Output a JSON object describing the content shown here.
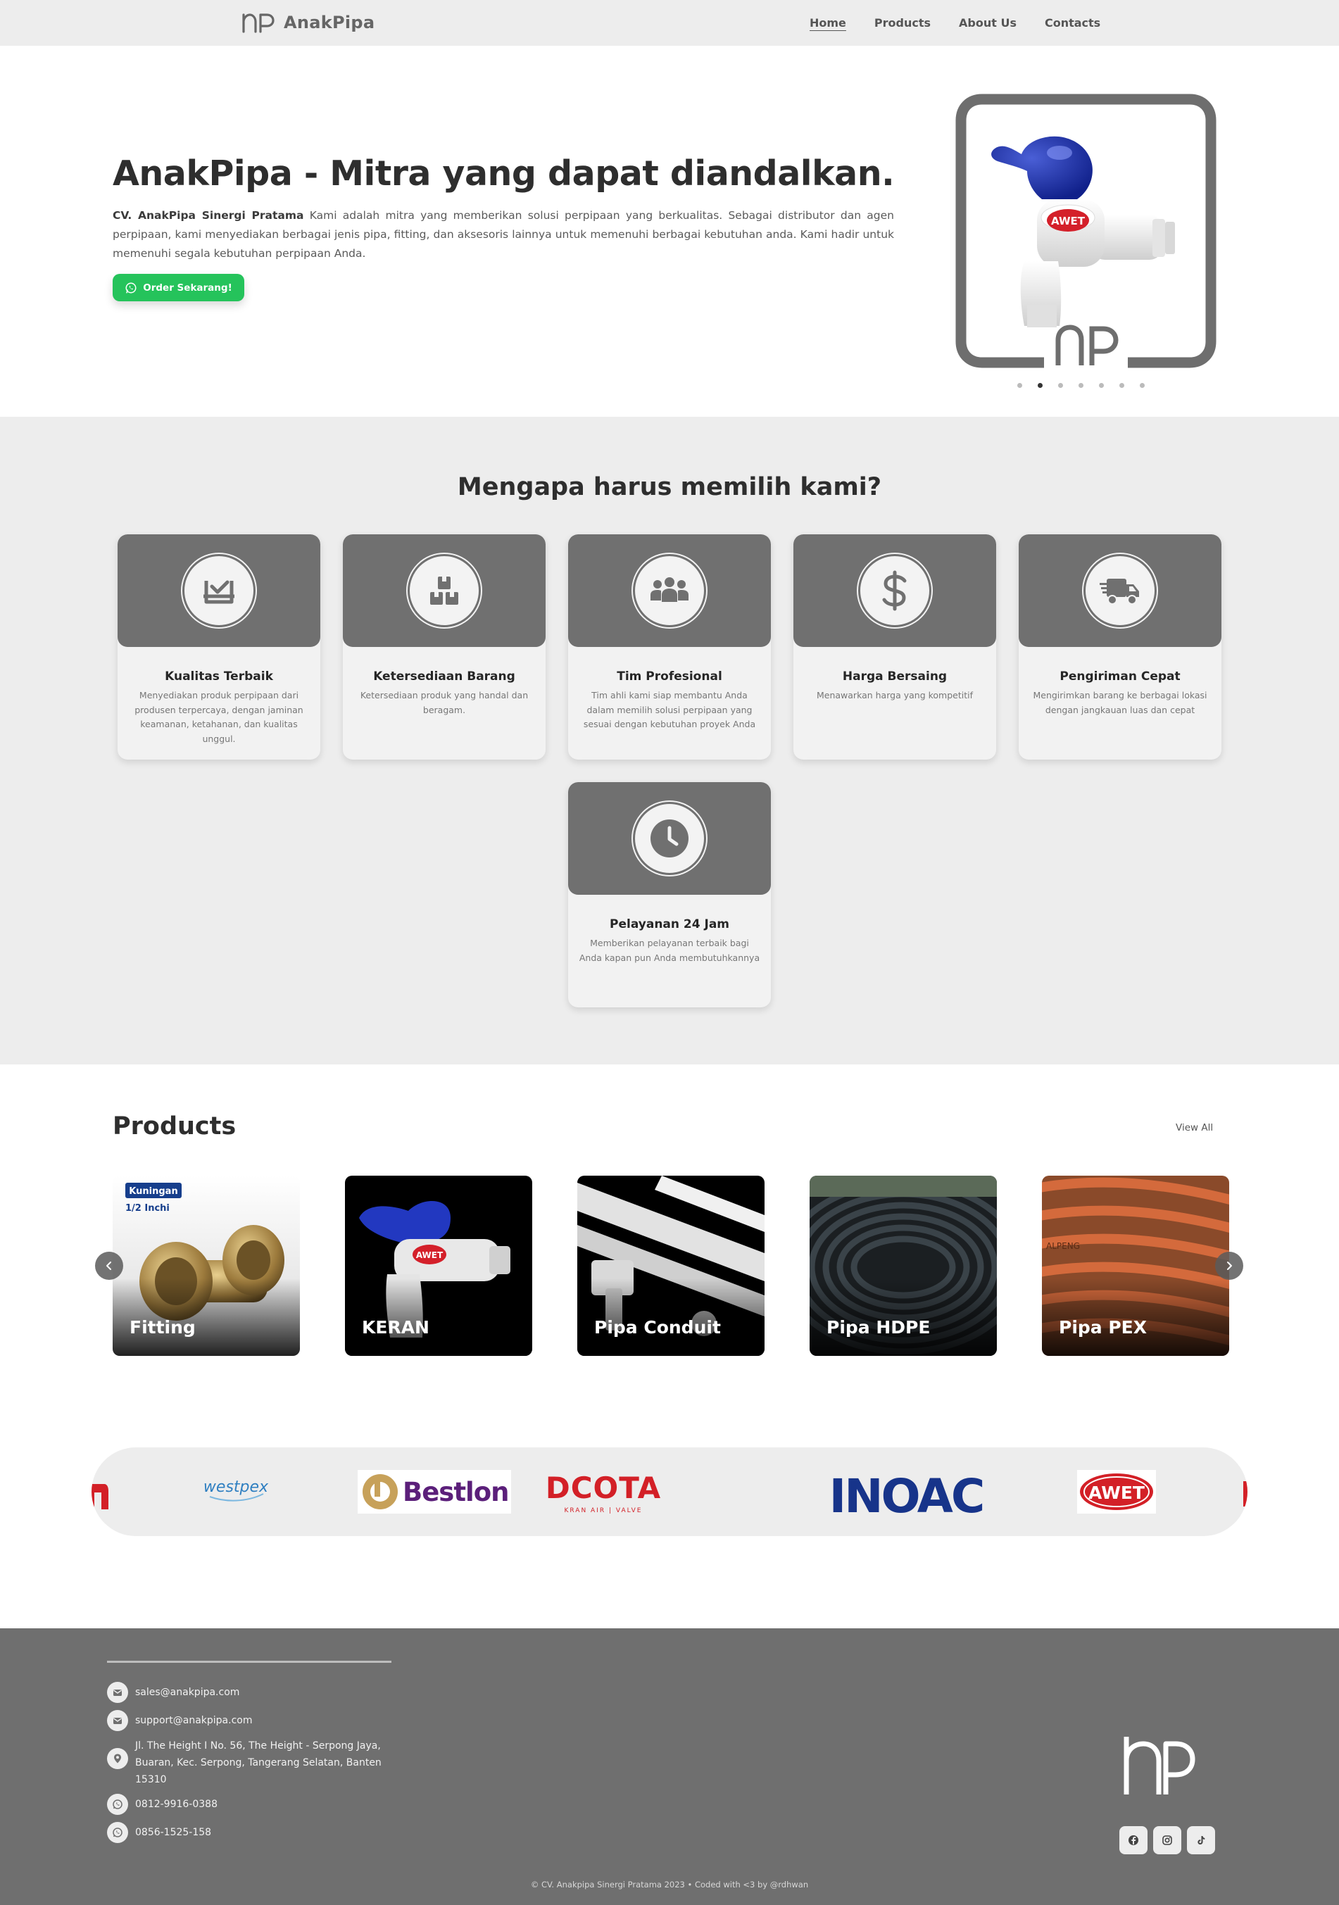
{
  "nav": {
    "brand": "AnakPipa",
    "links": [
      "Home",
      "Products",
      "About Us",
      "Contacts"
    ]
  },
  "hero": {
    "title": "AnakPipa - Mitra yang dapat diandalkan.",
    "company": "CV. AnakPipa Sinergi Pratama",
    "description": " Kami adalah mitra yang memberikan solusi perpipaan yang berkualitas. Sebagai distributor dan agen perpipaan, kami menyediakan berbagai jenis pipa, fitting, dan aksesoris lainnya untuk memenuhi berbagai kebutuhan anda. Kami hadir untuk memenuhi segala kebutuhan perpipaan Anda.",
    "cta": "Order Sekarang!",
    "carousel_dots": 7,
    "active_dot": 1,
    "image_brand": "AWET"
  },
  "why": {
    "title": "Mengapa harus memilih kami?",
    "cards": [
      {
        "title": "Kualitas Terbaik",
        "desc": "Menyediakan produk perpipaan dari produsen terpercaya, dengan jaminan keamanan, ketahanan, dan kualitas unggul.",
        "icon": "quality-check-icon"
      },
      {
        "title": "Ketersediaan Barang",
        "desc": "Ketersediaan produk yang handal dan beragam.",
        "icon": "boxes-icon"
      },
      {
        "title": "Tim Profesional",
        "desc": "Tim ahli kami siap membantu Anda dalam memilih solusi perpipaan yang sesuai dengan kebutuhan proyek Anda",
        "icon": "team-icon"
      },
      {
        "title": "Harga Bersaing",
        "desc": "Menawarkan harga yang kompetitif",
        "icon": "dollar-icon"
      },
      {
        "title": "Pengiriman Cepat",
        "desc": "Mengirimkan barang ke berbagai lokasi dengan jangkauan luas dan cepat",
        "icon": "truck-icon"
      },
      {
        "title": "Pelayanan 24 Jam",
        "desc": "Memberikan pelayanan terbaik bagi Anda kapan pun Anda membutuhkannya",
        "icon": "clock-icon"
      }
    ]
  },
  "products": {
    "title": "Products",
    "view_all": "View All",
    "items": [
      {
        "label": "Fitting",
        "tag1": "Kuningan",
        "tag2": "1/2 Inchi"
      },
      {
        "label": "KERAN",
        "badge": "AWET"
      },
      {
        "label": "Pipa Conduit"
      },
      {
        "label": "Pipa HDPE"
      },
      {
        "label": "Pipa PEX",
        "print": "ALPENG"
      }
    ]
  },
  "brands": {
    "items": [
      "westpex",
      "Bestlon",
      "DCOTA",
      "KRAN AIR | VALVE",
      "INOAC",
      "AWET"
    ]
  },
  "footer": {
    "emails": [
      "sales@anakpipa.com",
      "support@anakpipa.com"
    ],
    "address": "Jl. The Height I No. 56, The Height - Serpong Jaya, Buaran, Kec. Serpong, Tangerang Selatan, Banten 15310",
    "phones": [
      "0812-9916-0388",
      "0856-1525-158"
    ],
    "copyright": "© CV. Anakpipa Sinergi Pratama 2023 • Coded with <3 by @rdhwan"
  },
  "colors": {
    "nav_bg": "#ededed",
    "accent_green": "#25c35b",
    "card_gray": "#707070",
    "footer_bg": "#6f6f6f"
  }
}
